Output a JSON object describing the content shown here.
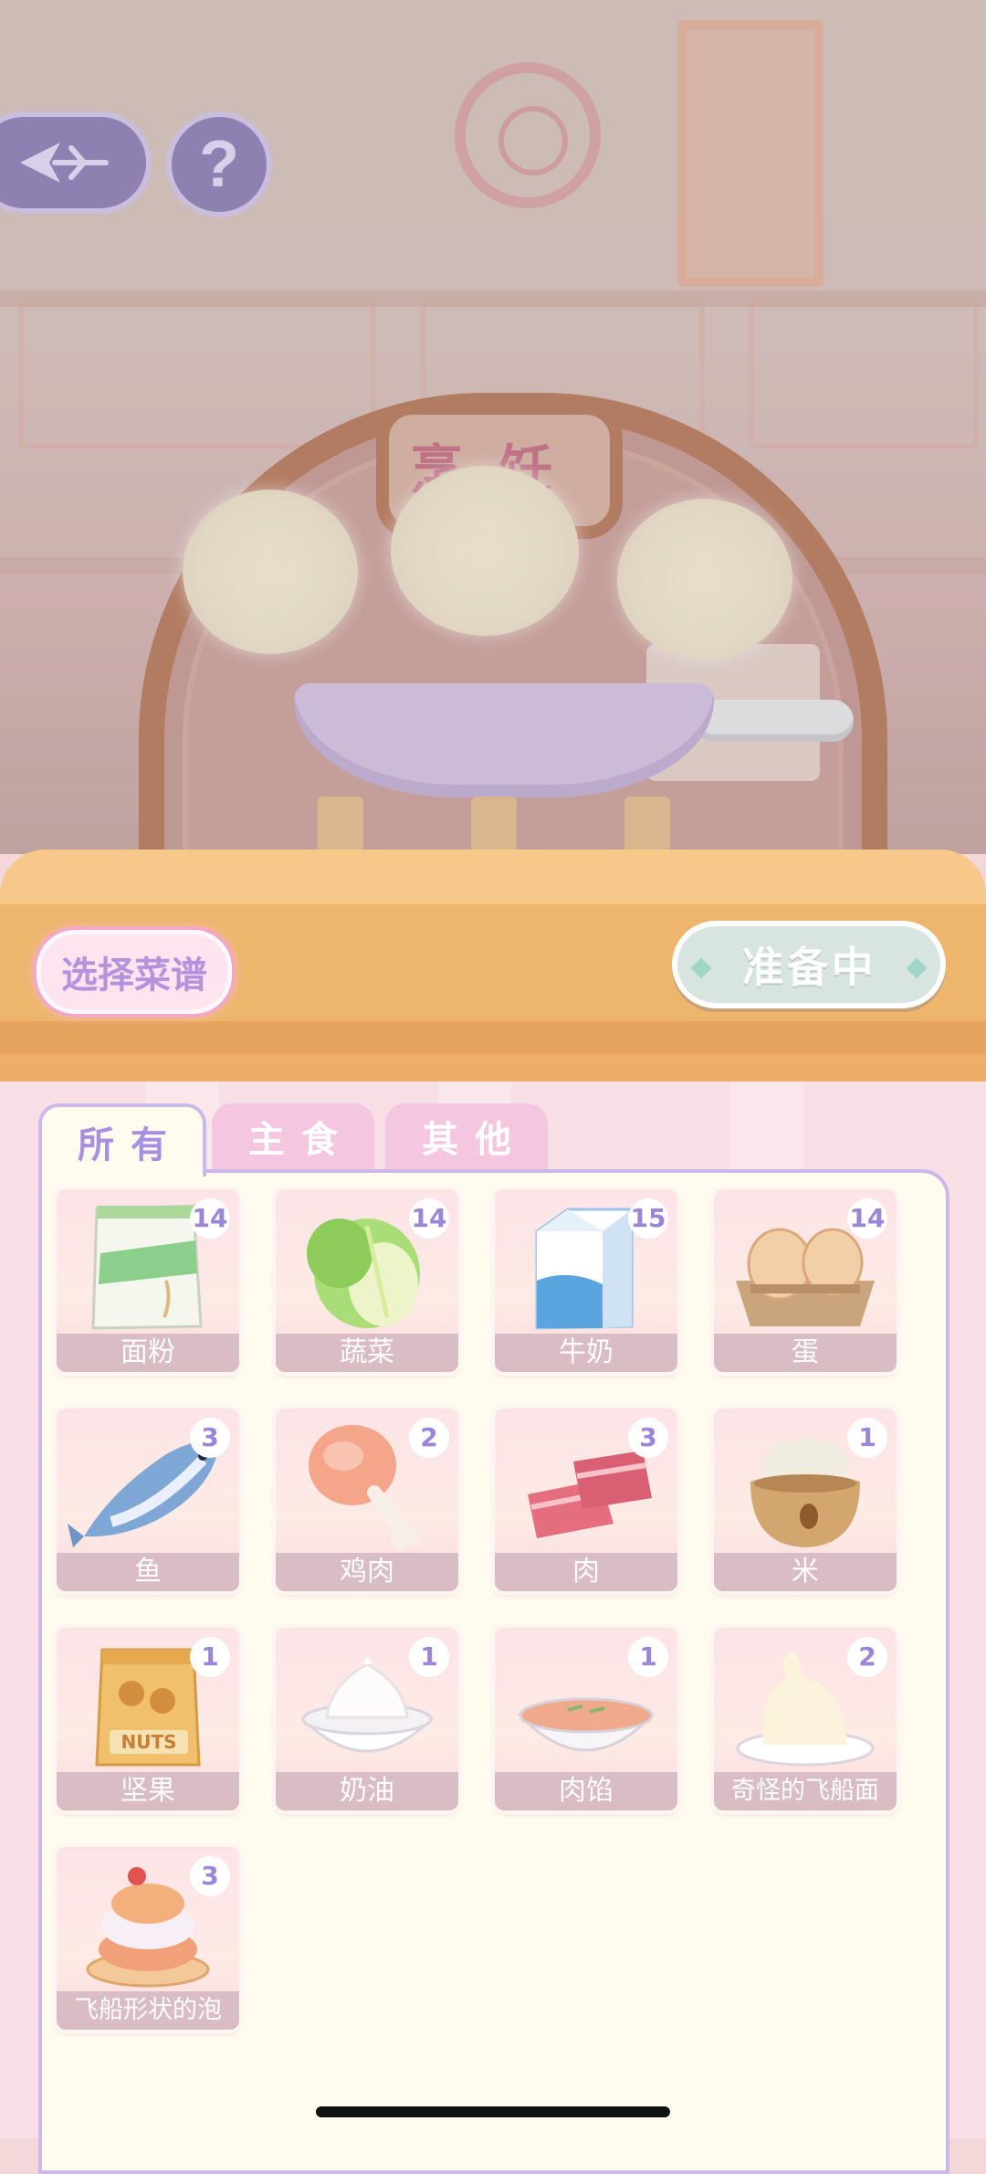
{
  "scene": {
    "sign_text": "烹饪"
  },
  "top_buttons": {
    "back_icon": "back-arrow-icon",
    "help_label": "?"
  },
  "counter": {
    "recipe_button_label": "选择菜谱",
    "status_button_label": "准备中"
  },
  "tabs": [
    {
      "label": "所有",
      "active": true
    },
    {
      "label": "主食",
      "active": false
    },
    {
      "label": "其他",
      "active": false
    }
  ],
  "items": [
    {
      "name": "面粉",
      "count": "14",
      "icon": "flour-bag-icon"
    },
    {
      "name": "蔬菜",
      "count": "14",
      "icon": "cabbage-icon"
    },
    {
      "name": "牛奶",
      "count": "15",
      "icon": "milk-carton-icon"
    },
    {
      "name": "蛋",
      "count": "14",
      "icon": "egg-tray-icon"
    },
    {
      "name": "鱼",
      "count": "3",
      "icon": "fish-icon"
    },
    {
      "name": "鸡肉",
      "count": "2",
      "icon": "chicken-leg-icon"
    },
    {
      "name": "肉",
      "count": "3",
      "icon": "meat-icon"
    },
    {
      "name": "米",
      "count": "1",
      "icon": "rice-sack-icon"
    },
    {
      "name": "坚果",
      "count": "1",
      "icon": "nuts-bag-icon"
    },
    {
      "name": "奶油",
      "count": "1",
      "icon": "cream-bowl-icon"
    },
    {
      "name": "肉馅",
      "count": "1",
      "icon": "minced-meat-bowl-icon"
    },
    {
      "name": "奇怪的飞船面",
      "count": "2",
      "icon": "strange-dough-icon"
    },
    {
      "name": "飞船形状的泡",
      "count": "3",
      "icon": "puff-pastry-icon"
    }
  ],
  "nuts_bag_text": "NUTS",
  "colors": {
    "accent_purple": "#a88fe0",
    "counter_orange": "#eeb56c",
    "panel_cream": "#fffcef",
    "status_button": "#d8e4e0"
  }
}
